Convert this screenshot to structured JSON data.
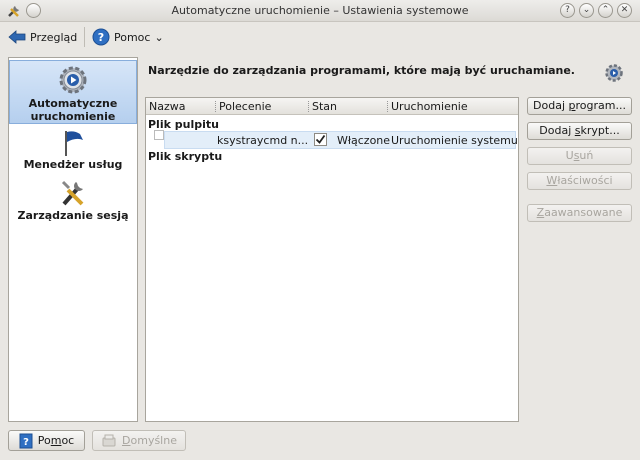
{
  "window": {
    "title": "Automatyczne uruchomienie – Ustawienia systemowe"
  },
  "toolbar": {
    "back_label": "Przegląd",
    "help_label": "Pomoc",
    "help_icon_glyph": "?",
    "dropdown_glyph": "⌄"
  },
  "sidebar": {
    "items": [
      {
        "label": "Automatyczne uruchomienie",
        "icon": "autostart-gear-icon",
        "active": true
      },
      {
        "label": "Menedżer usług",
        "icon": "flag-icon",
        "active": false
      },
      {
        "label": "Zarządzanie sesją",
        "icon": "tools-icon",
        "active": false
      }
    ]
  },
  "main": {
    "heading": "Narzędzie do zarządzania programami, które mają być uruchamiane."
  },
  "tree": {
    "columns": [
      "Nazwa",
      "Polecenie",
      "Stan",
      "Uruchomienie"
    ],
    "groups": [
      {
        "label": "Plik pulpitu",
        "rows": [
          {
            "name": "",
            "command": "ksystraycmd n...",
            "state": "Włączone",
            "startup": "Uruchomienie systemu",
            "checked": true
          }
        ]
      },
      {
        "label": "Plik skryptu",
        "rows": []
      }
    ]
  },
  "buttons": {
    "add_program_pre": "Dodaj ",
    "add_program_ul": "p",
    "add_program_post": "rogram...",
    "add_script_pre": "Dodaj ",
    "add_script_ul": "s",
    "add_script_post": "krypt...",
    "remove_pre": "U",
    "remove_ul": "s",
    "remove_post": "uń",
    "properties_pre": "",
    "properties_ul": "W",
    "properties_post": "łaściwości",
    "advanced_pre": "",
    "advanced_ul": "Z",
    "advanced_post": "aawansowane"
  },
  "footer": {
    "help_pre": "Po",
    "help_ul": "m",
    "help_post": "oc",
    "help_icon_glyph": "?",
    "defaults_pre": "",
    "defaults_ul": "D",
    "defaults_post": "omyślne"
  },
  "colors": {
    "accent": "#b5cfee",
    "selection": "#e3eef9"
  }
}
